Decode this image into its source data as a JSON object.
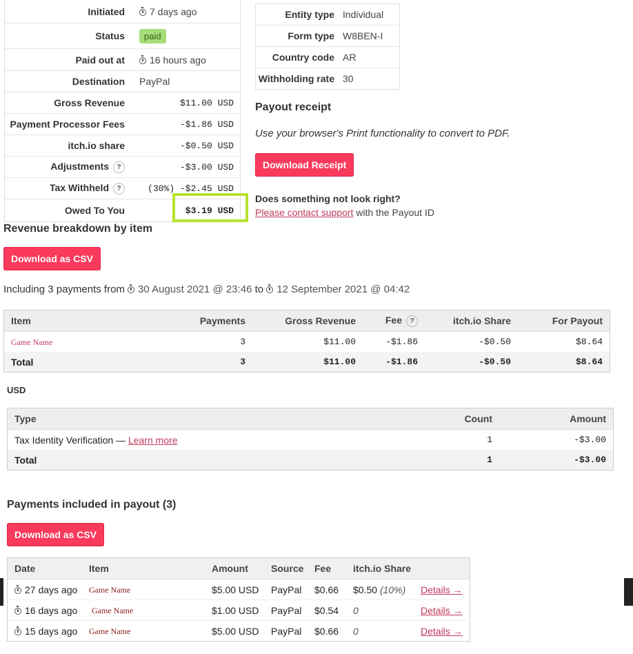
{
  "summary": {
    "initiated_label": "Initiated",
    "initiated_value": "7 days ago",
    "status_label": "Status",
    "status_value": "paid",
    "paid_out_label": "Paid out at",
    "paid_out_value": "16 hours ago",
    "destination_label": "Destination",
    "destination_value": "PayPal",
    "gross_label": "Gross Revenue",
    "gross_value": "$11.00 USD",
    "fees_label": "Payment Processor Fees",
    "fees_value": "-$1.86 USD",
    "share_label": "itch.io share",
    "share_value": "-$0.50 USD",
    "adjust_label": "Adjustments",
    "adjust_value": "-$3.00 USD",
    "tax_label": "Tax Withheld",
    "tax_value": "(30%) -$2.45 USD",
    "owed_label": "Owed To You",
    "owed_value": "$3.19 USD",
    "help_glyph": "?"
  },
  "entity": {
    "rows": [
      {
        "label": "Entity type",
        "value": "Individual"
      },
      {
        "label": "Form type",
        "value": "W8BEN-I"
      },
      {
        "label": "Country code",
        "value": "AR"
      },
      {
        "label": "Withholding rate",
        "value": "30"
      }
    ]
  },
  "receipt": {
    "title": "Payout receipt",
    "note": "Use your browser's Print functionality to convert to PDF.",
    "button": "Download Receipt",
    "question": "Does something not look right?",
    "contact_link": "Please contact support",
    "contact_suffix": " with the Payout ID"
  },
  "revenue": {
    "title": "Revenue breakdown by item",
    "csv_button": "Download as CSV",
    "including_prefix": "Including 3 payments from",
    "from_date": "30 August 2021 @ 23:46",
    "to_word": "to",
    "to_date": "12 September 2021 @ 04:42",
    "headers": {
      "item": "Item",
      "payments": "Payments",
      "gross": "Gross Revenue",
      "fee": "Fee",
      "share": "itch.io Share",
      "payout": "For Payout"
    },
    "row": {
      "item": "Game Name",
      "payments": "3",
      "gross": "$11.00",
      "fee": "-$1.86",
      "share": "-$0.50",
      "payout": "$8.64"
    },
    "total": {
      "label": "Total",
      "payments": "3",
      "gross": "$11.00",
      "fee": "-$1.86",
      "share": "-$0.50",
      "payout": "$8.64"
    }
  },
  "adjustments": {
    "currency": "USD",
    "headers": {
      "type": "Type",
      "count": "Count",
      "amount": "Amount"
    },
    "row": {
      "type": "Tax Identity Verification — ",
      "link": "Learn more",
      "count": "1",
      "amount": "-$3.00"
    },
    "total": {
      "label": "Total",
      "count": "1",
      "amount": "-$3.00"
    }
  },
  "payments": {
    "title": "Payments included in payout (3)",
    "csv_button": "Download as CSV",
    "headers": {
      "date": "Date",
      "item": "Item",
      "amount": "Amount",
      "source": "Source",
      "fee": "Fee",
      "share": "itch.io Share"
    },
    "rows": [
      {
        "date": "27 days ago",
        "item": "Game Name",
        "amount": "$5.00 USD",
        "source": "PayPal",
        "fee": "$0.66",
        "share": "$0.50",
        "share_pct": "(10%)",
        "details": "Details →"
      },
      {
        "date": "16 days ago",
        "item": "Game Name",
        "amount": "$1.00 USD",
        "source": "PayPal",
        "fee": "$0.54",
        "share": "0",
        "share_pct": "",
        "details": "Details →"
      },
      {
        "date": "15 days ago",
        "item": "Game Name",
        "amount": "$5.00 USD",
        "source": "PayPal",
        "fee": "$0.66",
        "share": "0",
        "share_pct": "",
        "details": "Details →"
      }
    ]
  },
  "colors": {
    "accent": "#fa3a5c",
    "highlight": "#b6e22e",
    "paid_badge": "#a6dd7b"
  }
}
